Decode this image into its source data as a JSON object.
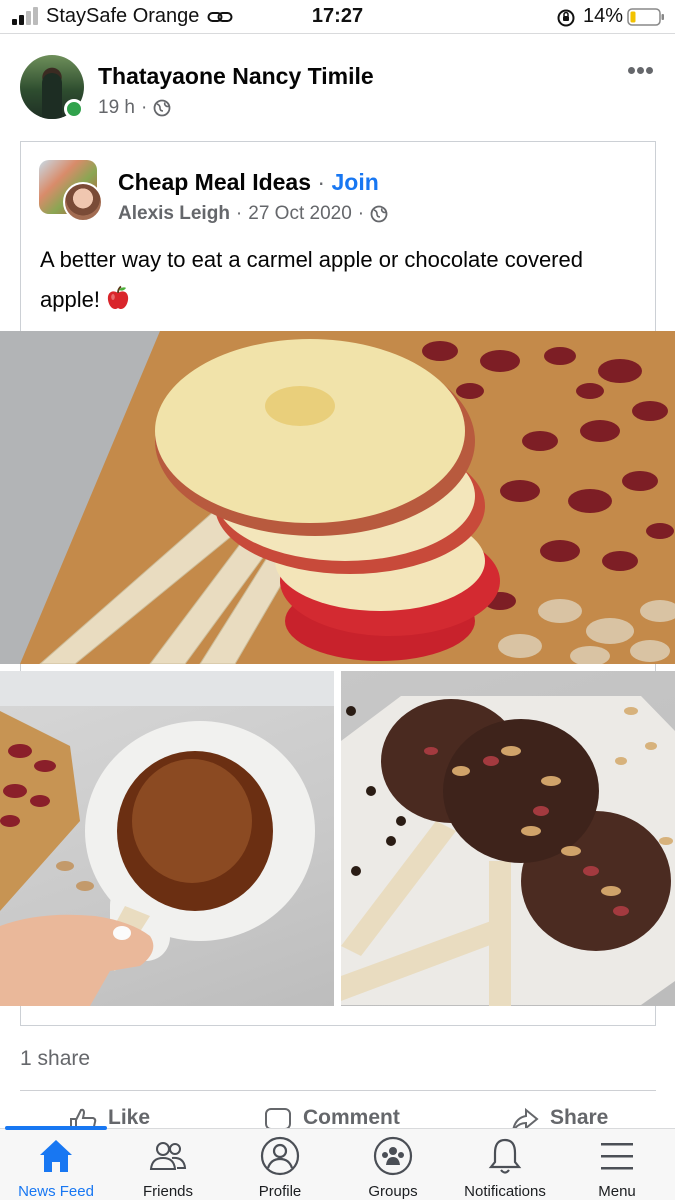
{
  "status_bar": {
    "carrier": "StaySafe Orange",
    "time": "17:27",
    "battery": "14%"
  },
  "post": {
    "author": "Thatayaone Nancy Timile",
    "time": "19 h",
    "separator": "·",
    "shared": {
      "group": "Cheap Meal Ideas",
      "separator": "·",
      "join_label": "Join",
      "author": "Alexis Leigh",
      "date": "27 Oct 2020",
      "text": "A better way to eat a carmel apple or chocolate covered apple!"
    },
    "share_count": "1 share",
    "actions": {
      "like": "Like",
      "comment": "Comment",
      "share": "Share"
    }
  },
  "tab_bar": {
    "tabs": [
      {
        "label": "News Feed",
        "icon": "home-icon",
        "active": true
      },
      {
        "label": "Friends",
        "icon": "friends-icon",
        "active": false
      },
      {
        "label": "Profile",
        "icon": "profile-icon",
        "active": false
      },
      {
        "label": "Groups",
        "icon": "groups-icon",
        "active": false
      },
      {
        "label": "Notifications",
        "icon": "bell-icon",
        "active": false
      },
      {
        "label": "Menu",
        "icon": "menu-icon",
        "active": false
      }
    ]
  },
  "colors": {
    "accent": "#1877f2",
    "secondary_text": "#65676b",
    "online": "#31a24c"
  }
}
